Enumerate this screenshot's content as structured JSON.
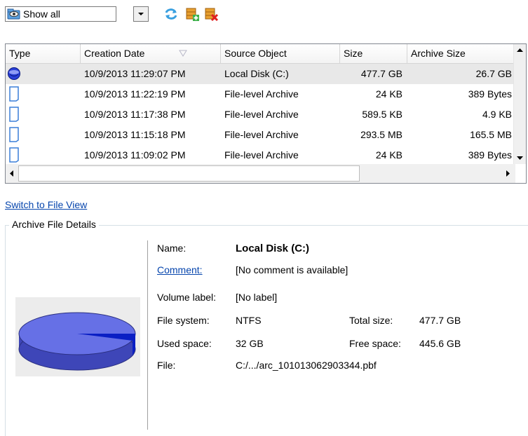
{
  "toolbar": {
    "filter_value": "Show all",
    "buttons": [
      {
        "name": "refresh",
        "icon": "refresh-icon"
      },
      {
        "name": "add-archive",
        "icon": "database-add-icon"
      },
      {
        "name": "delete-archive",
        "icon": "database-delete-icon"
      }
    ]
  },
  "table": {
    "columns": [
      "Type",
      "Creation Date",
      "Source Object",
      "Size",
      "Archive Size"
    ],
    "sorted_column": "Creation Date",
    "rows": [
      {
        "type_icon": "disk-backup-icon",
        "date": "10/9/2013 11:29:07 PM",
        "source": "Local Disk (C:)",
        "size": "477.7 GB",
        "archive_size": "26.7 GB",
        "selected": true
      },
      {
        "type_icon": "file-archive-icon",
        "date": "10/9/2013 11:22:19 PM",
        "source": "File-level Archive",
        "size": "24 KB",
        "archive_size": "389 Bytes",
        "selected": false
      },
      {
        "type_icon": "file-archive-icon",
        "date": "10/9/2013 11:17:38 PM",
        "source": "File-level Archive",
        "size": "589.5 KB",
        "archive_size": "4.9 KB",
        "selected": false
      },
      {
        "type_icon": "file-archive-icon",
        "date": "10/9/2013 11:15:18 PM",
        "source": "File-level Archive",
        "size": "293.5 MB",
        "archive_size": "165.5 MB",
        "selected": false
      },
      {
        "type_icon": "file-archive-icon",
        "date": "10/9/2013 11:09:02 PM",
        "source": "File-level Archive",
        "size": "24 KB",
        "archive_size": "389 Bytes",
        "selected": false
      }
    ]
  },
  "switch_view_link": "Switch to File View",
  "details": {
    "group_title": "Archive File Details",
    "name_label": "Name:",
    "name_value": "Local Disk (C:)",
    "comment_label": "Comment:",
    "comment_value": "[No comment is available]",
    "volume_label_label": "Volume label:",
    "volume_label_value": "[No label]",
    "file_system_label": "File system:",
    "file_system_value": "NTFS",
    "total_size_label": "Total size:",
    "total_size_value": "477.7 GB",
    "used_space_label": "Used space:",
    "used_space_value": "32 GB",
    "free_space_label": "Free space:",
    "free_space_value": "445.6 GB",
    "file_label": "File:",
    "file_value": "C:/.../arc_101013062903344.pbf",
    "disk_usage_fraction": 0.067
  },
  "colors": {
    "selection": "#e8e8e8",
    "link": "#0645ad",
    "pie_fill": "#6670e6",
    "pie_used": "#0a1fc4"
  }
}
